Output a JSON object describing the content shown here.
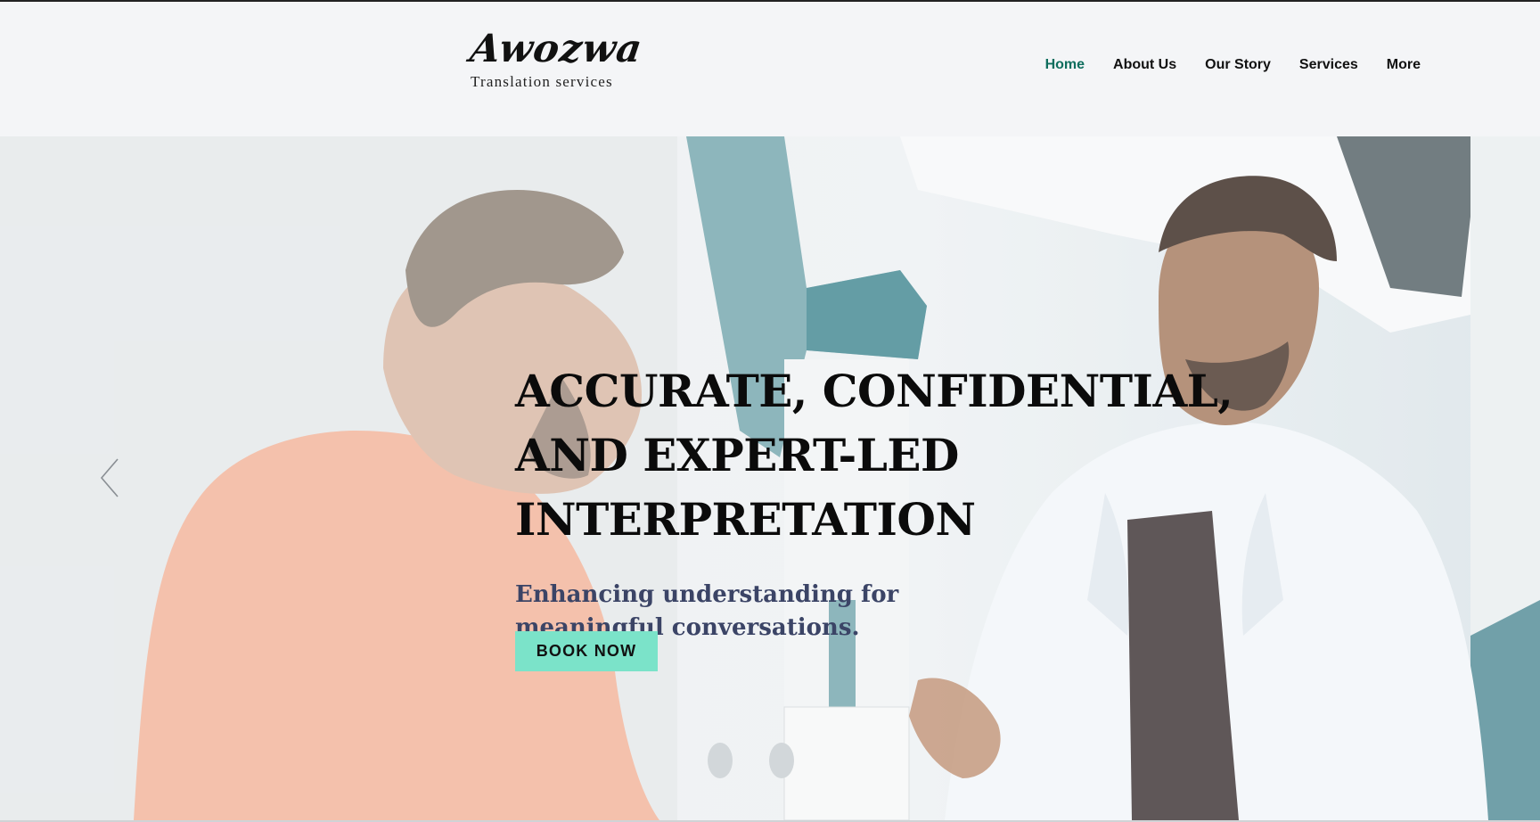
{
  "brand": {
    "name": "Awozwa",
    "tagline": "Translation services"
  },
  "nav": {
    "items": [
      {
        "label": "Home",
        "active": true
      },
      {
        "label": "About Us",
        "active": false
      },
      {
        "label": "Our Story",
        "active": false
      },
      {
        "label": "Services",
        "active": false
      },
      {
        "label": "More",
        "active": false
      }
    ]
  },
  "hero": {
    "headline_lines": [
      "ACCURATE, CONFIDENTIAL,",
      "AND EXPERT-LED",
      "INTERPRETATION"
    ],
    "subheading": "Enhancing understanding for meaningful conversations.",
    "cta_label": "BOOK NOW",
    "prev_arrow_icon": "chevron-left-icon",
    "background_image": "patient-and-doctor-conversation-photo"
  },
  "colors": {
    "header_bg": "#f4f5f7",
    "nav_active": "#0f6e5e",
    "cta_bg": "#7be3c9",
    "subheading": "#3b4466"
  }
}
